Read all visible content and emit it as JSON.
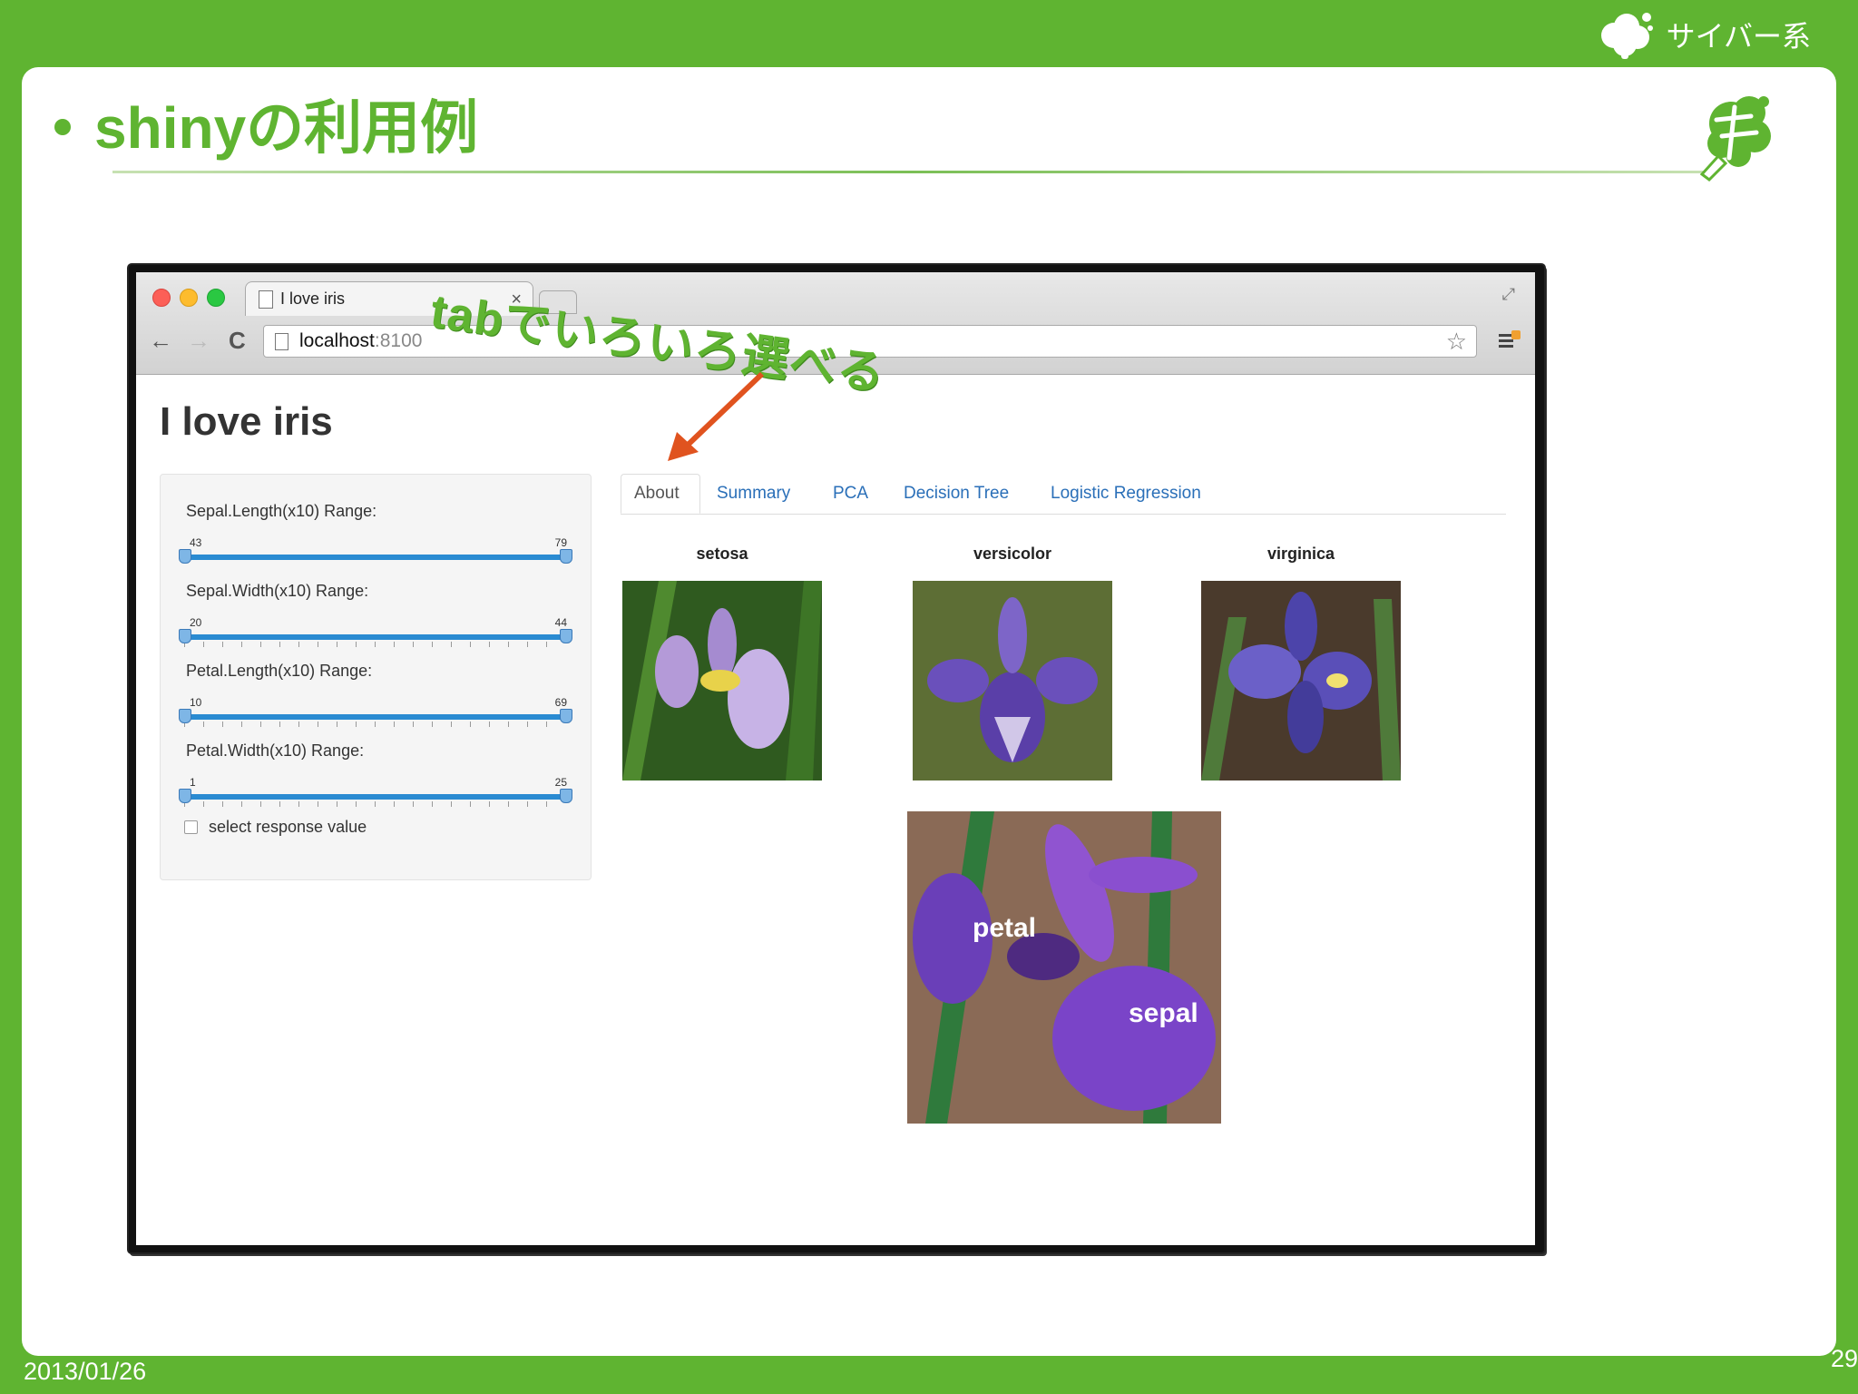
{
  "slide": {
    "title": "shinyの利用例",
    "brand": "サイバー系",
    "date": "2013/01/26",
    "page_number": "29",
    "annotation": "tabでいろいろ選べる"
  },
  "browser": {
    "tab_title": "I love iris",
    "tab_close": "×",
    "url_host": "localhost",
    "url_port": ":8100",
    "back_icon": "←",
    "forward_icon": "→",
    "reload_icon": "C",
    "bookmark_icon": "☆"
  },
  "app": {
    "title": "I love iris",
    "sliders": [
      {
        "label": "Sepal.Length(x10) Range:",
        "min": "43",
        "max": "79",
        "value_low": 43,
        "value_high": 79
      },
      {
        "label": "Sepal.Width(x10) Range:",
        "min": "20",
        "max": "44",
        "value_low": 20,
        "value_high": 44
      },
      {
        "label": "Petal.Length(x10) Range:",
        "min": "10",
        "max": "69",
        "value_low": 10,
        "value_high": 69
      },
      {
        "label": "Petal.Width(x10) Range:",
        "min": "1",
        "max": "25",
        "value_low": 1,
        "value_high": 25
      }
    ],
    "checkbox_label": "select response value",
    "tabs": [
      "About",
      "Summary",
      "PCA",
      "Decision Tree",
      "Logistic Regression"
    ],
    "active_tab": "About",
    "species": [
      "setosa",
      "versicolor",
      "virginica"
    ],
    "anatomy_labels": {
      "petal": "petal",
      "sepal": "sepal"
    }
  },
  "colors": {
    "green": "#5fb431",
    "link_blue": "#2a6fb8",
    "slider_blue": "#2a8bd2",
    "arrow_orange": "#e0531f"
  }
}
